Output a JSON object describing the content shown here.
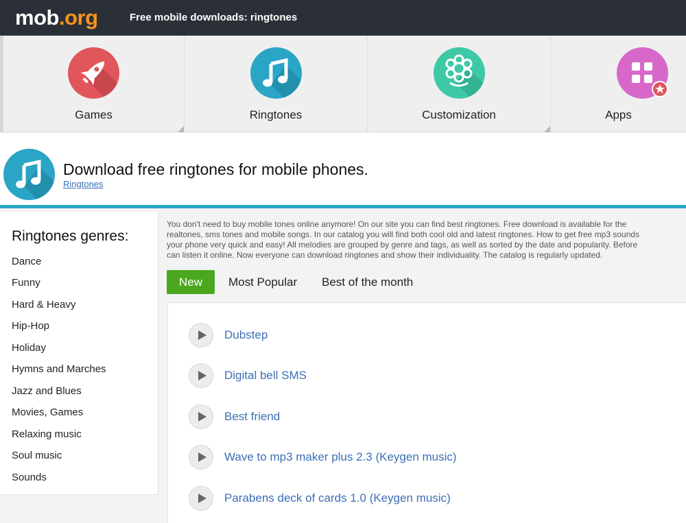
{
  "header": {
    "logo_main": "mob",
    "logo_dot": ".",
    "logo_tld": "org",
    "title": "Free mobile downloads: ringtones"
  },
  "categories": [
    {
      "label": "Games",
      "icon": "rocket-icon",
      "color": "#e0565b"
    },
    {
      "label": "Ringtones",
      "icon": "music-note-icon",
      "color": "#2aa5c6"
    },
    {
      "label": "Customization",
      "icon": "flower-icon",
      "color": "#3ec9a6"
    },
    {
      "label": "Apps",
      "icon": "apps-grid-icon",
      "color": "#d768c9"
    }
  ],
  "page": {
    "heading": "Download free ringtones for mobile phones.",
    "breadcrumb": "Ringtones"
  },
  "sidebar": {
    "title": "Ringtones genres:",
    "genres": [
      "Dance",
      "Funny",
      "Hard & Heavy",
      "Hip-Hop",
      "Holiday",
      "Hymns and Marches",
      "Jazz and Blues",
      "Movies, Games",
      "Relaxing music",
      "Soul music",
      "Sounds"
    ]
  },
  "intro": {
    "lines": [
      "You don't need to buy mobile tones online anymore! On our site you can find best ringtones. Free download is available for the",
      "realtones, sms tones and mobile songs. In our catalog you will find both cool old and latest ringtones. How to get free mp3 sounds",
      "your phone very quick and easy! All melodies are grouped by genre and tags, as well as sorted by the date and popularity. Before",
      "can listen it online. Now everyone can download ringtones and show their individuality. The catalog is regularly updated."
    ]
  },
  "tabs": [
    {
      "label": "New",
      "active": true
    },
    {
      "label": "Most Popular",
      "active": false
    },
    {
      "label": "Best of the month",
      "active": false
    }
  ],
  "ringtones": [
    {
      "title": "Dubstep"
    },
    {
      "title": "Digital bell SMS"
    },
    {
      "title": "Best friend"
    },
    {
      "title": "Wave to mp3 maker plus 2.3 (Keygen music)"
    },
    {
      "title": "Parabens deck of cards 1.0 (Keygen music)"
    }
  ],
  "colors": {
    "topbar": "#2b3038",
    "accent_orange": "#f7941d",
    "accent_blue": "#2aa5c6",
    "link": "#3a6fb5",
    "active_tab": "#4aa81e"
  }
}
